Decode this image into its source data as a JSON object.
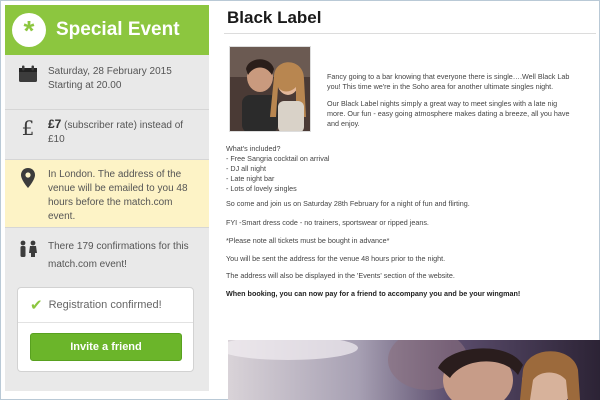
{
  "sidebar": {
    "event_title": "Special Event",
    "logo_glyph": "*",
    "date_line1": "Saturday, 28 February 2015",
    "date_line2": "Starting at 20.00",
    "price_amount": "£7",
    "price_note": "(subscriber rate) instead of",
    "price_original": "£10",
    "location_line1": "In London. The address of the",
    "location_line2": "venue will be emailed to you 48",
    "location_line3": "hours before the match.com",
    "location_line4": "event.",
    "confirmations_line1": "There 179 confirmations for this",
    "confirmations_line2": "match.com event!",
    "registration_status": "Registration confirmed!",
    "invite_button": "Invite a friend",
    "icons": {
      "calendar": "calendar-icon",
      "pound": "pound-icon",
      "location": "location-pin-icon",
      "people": "people-icon",
      "check": "check-icon"
    },
    "colors": {
      "brand_green": "#8cc63f",
      "button_green": "#6bb52a",
      "highlight_yellow": "#fdf3c6"
    }
  },
  "main": {
    "title": "Black Label",
    "intro_line1": "Fancy going to a bar knowing that everyone there is single….Well Black Lab",
    "intro_line2": "you! This time we're in the Soho area for another ultimate singles night.",
    "intro_line3": "Our Black Label nights simply a great way to meet singles with a late nig",
    "intro_line4": "more. Our fun - easy going atmosphere makes dating a breeze, all you have",
    "intro_line5": "and enjoy.",
    "included_heading": "What's included?",
    "included_1": "- Free Sangria cocktail on arrival",
    "included_2": "- DJ all night",
    "included_3": "- Late night bar",
    "included_4": "- Lots of lovely singles",
    "come_join": "So come and join us on Saturday 28th February for a night of fun and flirting.",
    "fyi": "FYI -Smart dress code - no trainers, sportswear or ripped jeans.",
    "note_tickets": "*Please note all tickets must be bought in advance*",
    "address_sent": "You will be sent the address for the venue 48 hours prior to the night.",
    "address_displayed": "The address will also be displayed in the 'Events' section of the website.",
    "booking_note": "When booking, you can now pay for a friend to accompany you and be your wingman!"
  }
}
